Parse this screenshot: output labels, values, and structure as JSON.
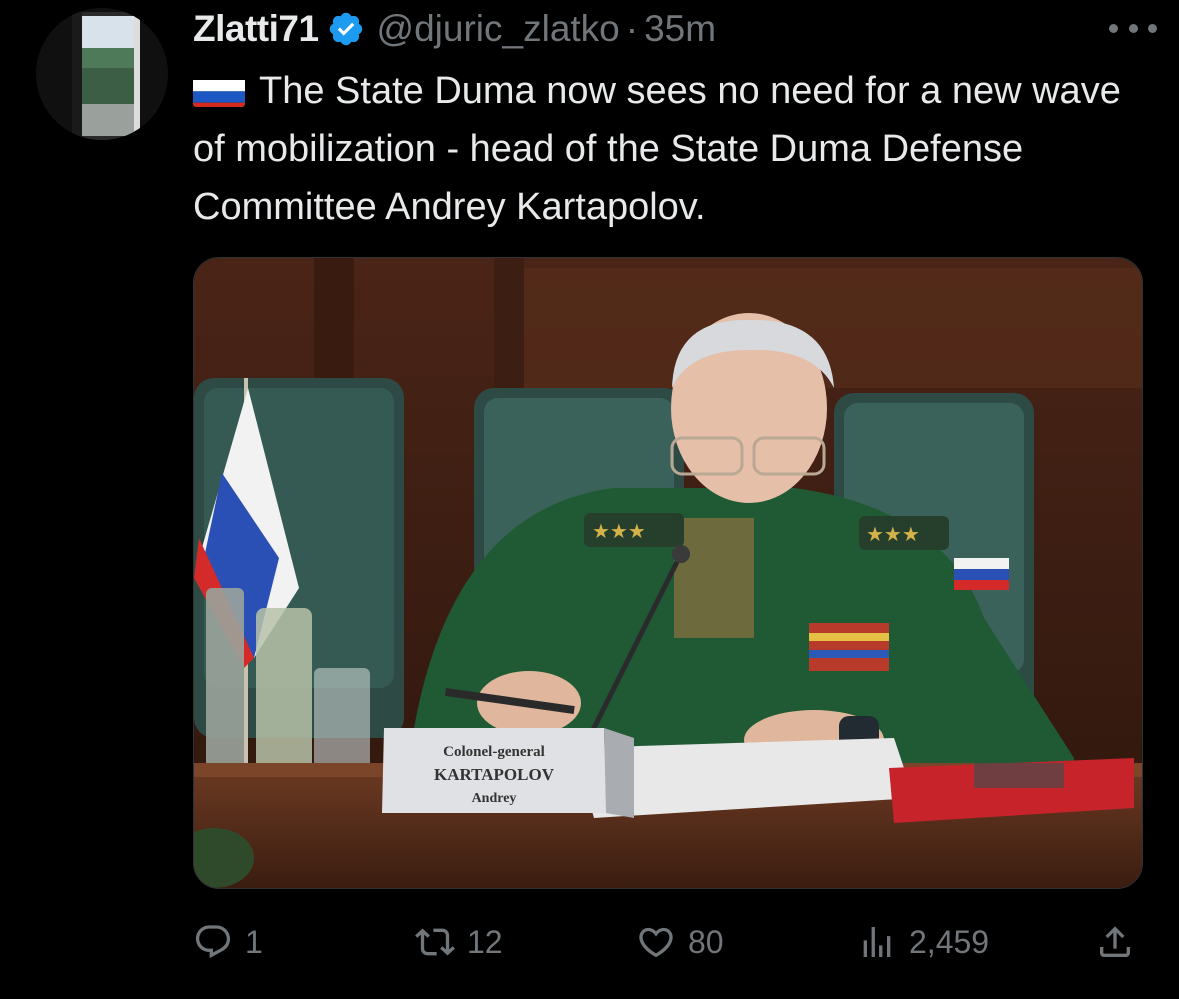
{
  "tweet": {
    "author_name": "Zlatti71",
    "handle": "@djuric_zlatko",
    "separator": "·",
    "time": "35m",
    "flag": "russia-flag-emoji",
    "text": "The State Duma now sees no need for a new wave of mobilization - head of the State Duma Defense Committee Andrey Kartapolov."
  },
  "media": {
    "nameplate_line1": "Colonel-general",
    "nameplate_line2": "KARTAPOLOV",
    "nameplate_line3": "Andrey"
  },
  "actions": {
    "reply_count": "1",
    "retweet_count": "12",
    "like_count": "80",
    "views_count": "2,459"
  },
  "colors": {
    "background": "#000000",
    "text": "#e7e9ea",
    "muted": "#71767b",
    "verified": "#1d9bf0"
  }
}
